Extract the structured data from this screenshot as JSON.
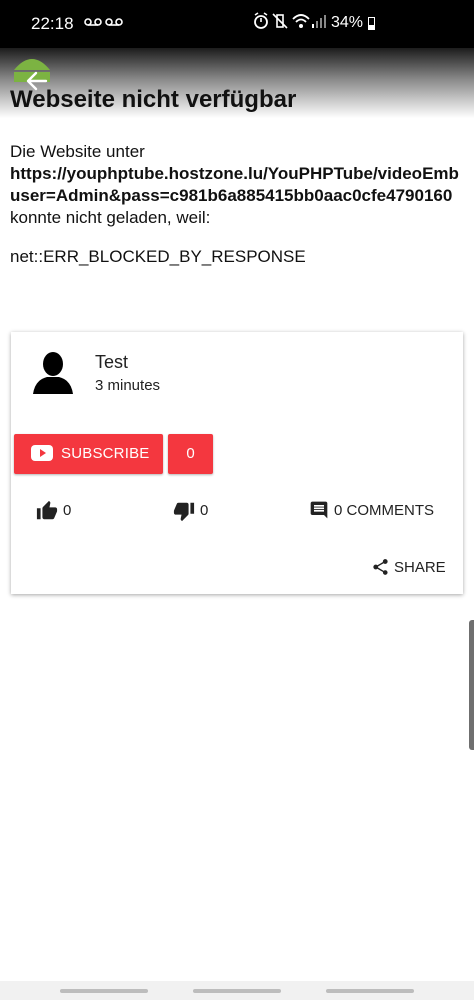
{
  "status_bar": {
    "time": "22:18",
    "notification_icons": [
      "voicemail-icon",
      "voicemail-icon"
    ],
    "system_icons": [
      "alarm-icon",
      "vibrate-icon",
      "wifi-icon",
      "signal-icon"
    ],
    "battery": "34%"
  },
  "error_page": {
    "title": "Webseite nicht verfügbar",
    "line1": "Die Website unter",
    "url_line1": "https://youphptube.hostzone.lu/YouPHPTube/videoEmb",
    "url_line2": "user=Admin&pass=c981b6a885415bb0aac0cfe4790160",
    "line2": "konnte nicht geladen, weil:",
    "error_code": "net::ERR_BLOCKED_BY_RESPONSE"
  },
  "card": {
    "channel_name": "Test",
    "time_ago": "3 minutes",
    "subscribe_label": "SUBSCRIBE",
    "subscriber_count": "0",
    "likes": "0",
    "dislikes": "0",
    "comments_label": "0 COMMENTS",
    "share_label": "SHARE"
  },
  "colors": {
    "accent": "#f4373f",
    "status_bar": "#000000"
  }
}
